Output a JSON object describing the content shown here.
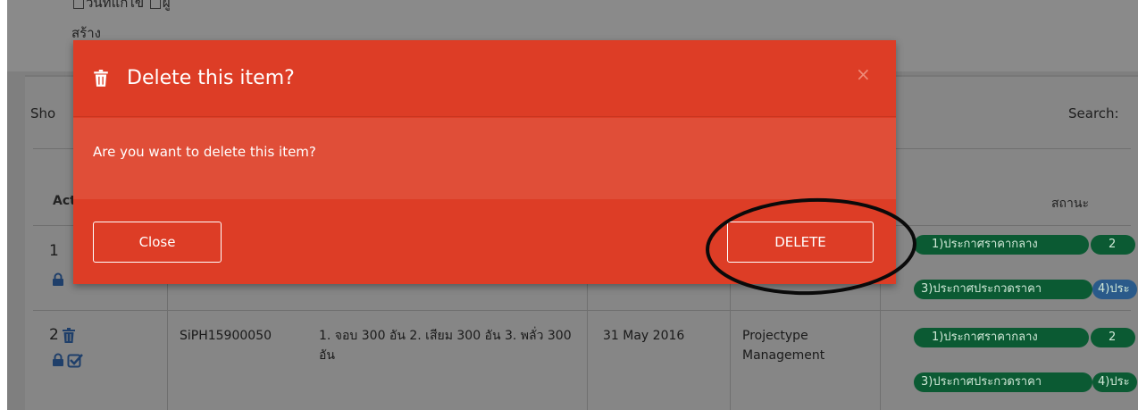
{
  "filters": {
    "line1": "วันที่แก้ไข",
    "line1b": "ผู้",
    "line2": "สร้าง"
  },
  "table_controls": {
    "show_label": "Sho",
    "search_label": "Search:"
  },
  "table": {
    "header_action": "Act",
    "header_status": "สถานะ",
    "rows": [
      {
        "num": "1",
        "status_pills": [
          "1)ประกาศราคากลาง",
          "2",
          "3)ประกาศประกวดราคา",
          "4)ประ"
        ]
      },
      {
        "num": "2",
        "code": "SiPH15900050",
        "description": "1. จอบ 300 อัน 2. เสียม 300 อัน 3. พลั่ว 300 อัน",
        "date": "31 May 2016",
        "type": "Projectype Management",
        "status_pills": [
          "1)ประกาศราคากลาง",
          "2",
          "3)ประกาศประกวดราคา",
          "4)ประ"
        ]
      }
    ]
  },
  "modal": {
    "title": "Delete this item?",
    "close_symbol": "×",
    "message": "Are you want to delete this item?",
    "close_button": "Close",
    "delete_button": "DELETE"
  },
  "colors": {
    "modal_bg": "#dd3d26",
    "modal_body_bg": "#e04e38",
    "pill_green": "#0b5a33",
    "pill_blue": "#2a5a8a"
  },
  "icons": {
    "header": "trash-icon",
    "row_delete": "trash-icon",
    "row_lock": "lock-icon",
    "row_edit": "checkbox-edit-icon"
  }
}
